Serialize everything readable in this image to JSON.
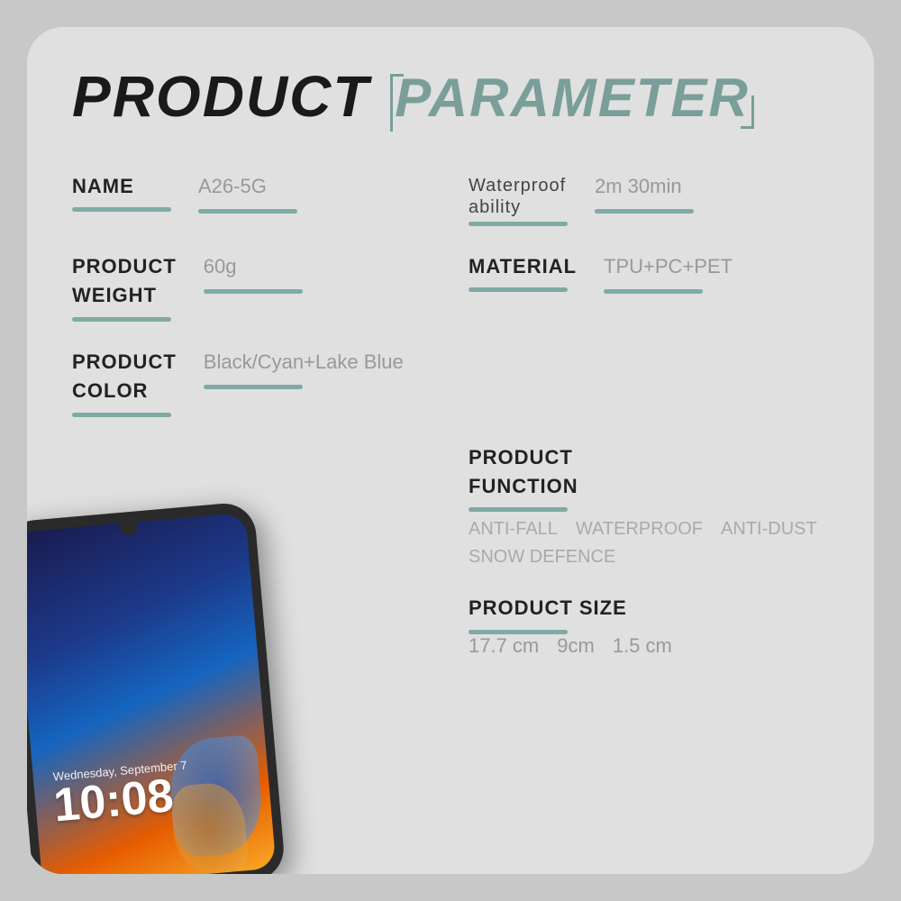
{
  "title": {
    "product": "PRODUCT",
    "parameter": "PARAMETER"
  },
  "params": {
    "name": {
      "label": "NAME",
      "value": "A26-5G"
    },
    "waterproof": {
      "label_line1": "Waterproof",
      "label_line2": "ability",
      "value": "2m  30min"
    },
    "product_weight": {
      "label_line1": "PRODUCT",
      "label_line2": "WEIGHT",
      "value": "60g"
    },
    "material": {
      "label": "MATERIAL",
      "value": "TPU+PC+PET"
    },
    "product_color": {
      "label_line1": "PRODUCT",
      "label_line2": "COLOR",
      "value": "Black/Cyan+Lake Blue"
    },
    "product_function": {
      "label_line1": "PRODUCT",
      "label_line2": "FUNCTION",
      "func1": "ANTI-FALL",
      "func2": "WATERPROOF",
      "func3": "ANTI-DUST",
      "func4": "SNOW DEFENCE"
    },
    "product_size": {
      "label": "PRODUCT SIZE",
      "val1": "17.7 cm",
      "val2": "9cm",
      "val3": "1.5 cm"
    }
  },
  "phone": {
    "date": "Wednesday, September 7",
    "time": "10:08"
  }
}
